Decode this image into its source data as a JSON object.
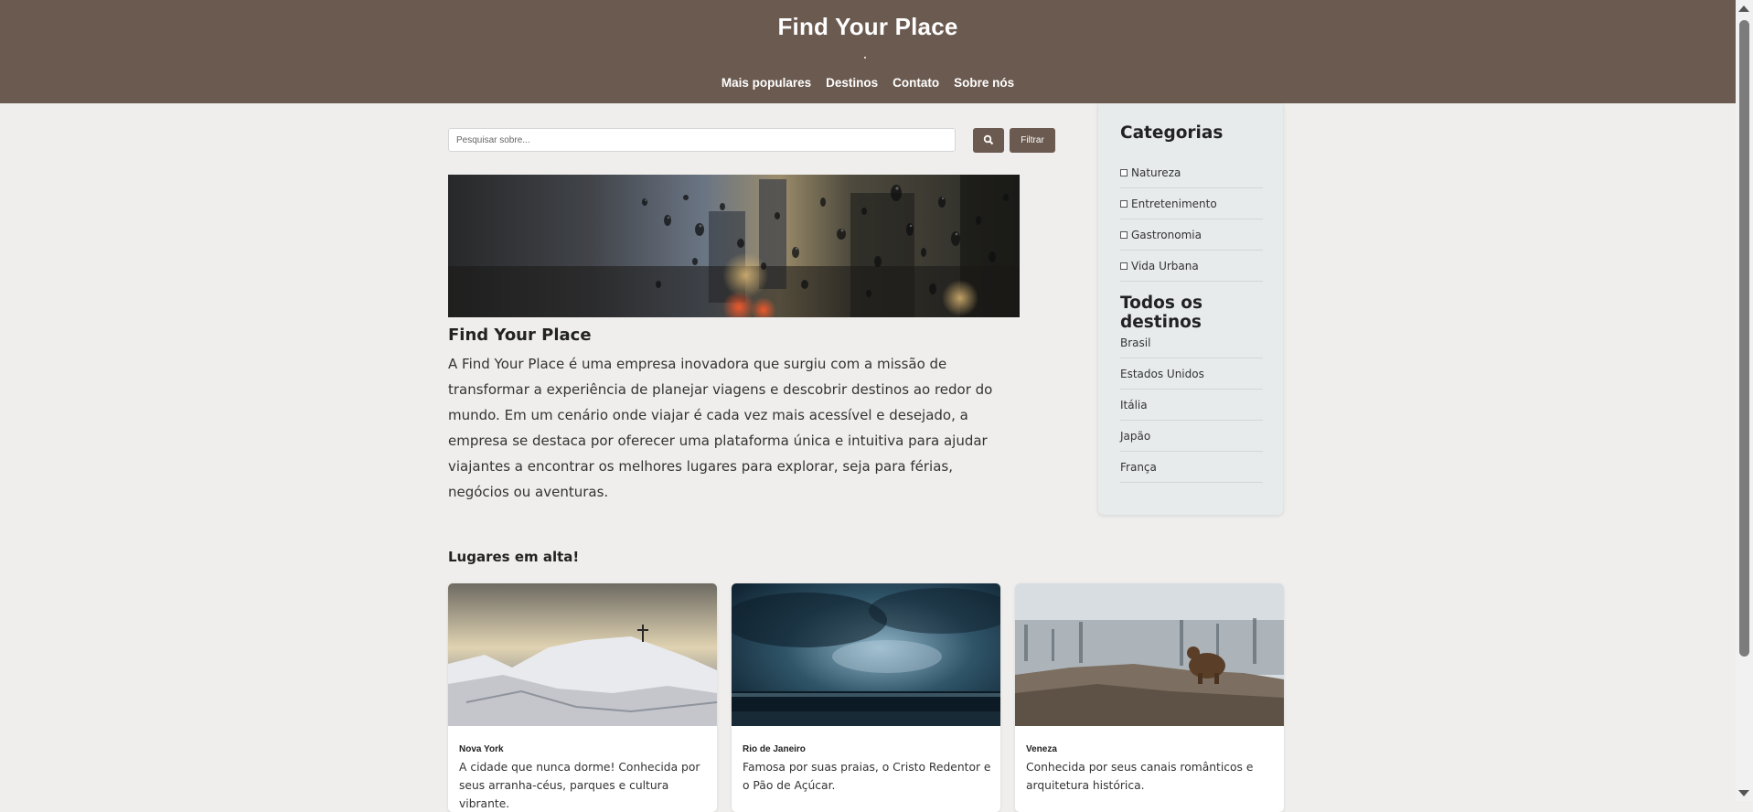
{
  "header": {
    "title": "Find Your Place",
    "nav": [
      "Mais populares",
      "Destinos",
      "Contato",
      "Sobre nós"
    ]
  },
  "search": {
    "placeholder": "Pesquisar sobre...",
    "filter_label": "Filtrar"
  },
  "hero": {
    "title": "Find Your Place",
    "text": "A Find Your Place é uma empresa inovadora que surgiu com a missão de transformar a experiência de planejar viagens e descobrir destinos ao redor do mundo. Em um cenário onde viajar é cada vez mais acessível e desejado, a empresa se destaca por oferecer uma plataforma única e intuitiva para ajudar viajantes a encontrar os melhores lugares para explorar, seja para férias, negócios ou aventuras."
  },
  "sidebar": {
    "categories_title": "Categorias",
    "categories": [
      "Natureza",
      "Entretenimento",
      "Gastronomia",
      "Vida Urbana"
    ],
    "destinations_title": "Todos os destinos",
    "destinations": [
      "Brasil",
      "Estados Unidos",
      "Itália",
      "Japão",
      "França"
    ]
  },
  "trending": {
    "title": "Lugares em alta!",
    "cards": [
      {
        "name": "Nova York",
        "desc": "A cidade que nunca dorme! Conhecida por seus arranha-céus, parques e cultura vibrante."
      },
      {
        "name": "Rio de Janeiro",
        "desc": "Famosa por suas praias, o Cristo Redentor e o Pão de Açúcar."
      },
      {
        "name": "Veneza",
        "desc": "Conhecida por seus canais românticos e arquitetura histórica."
      }
    ]
  },
  "colors": {
    "header_bg": "#6b5a4f",
    "page_bg": "#efeeec",
    "sidebar_bg": "#e8ebec"
  }
}
